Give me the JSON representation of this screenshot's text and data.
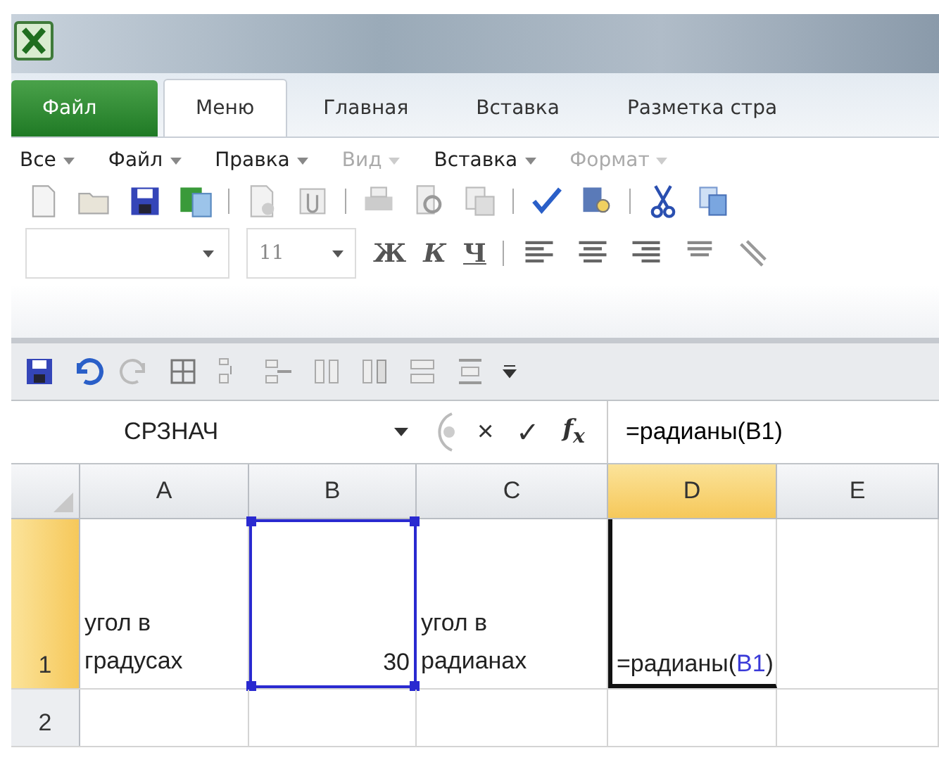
{
  "ribbon_tabs": [
    {
      "label": "Файл",
      "kind": "file",
      "selected": false
    },
    {
      "label": "Меню",
      "kind": "tab",
      "selected": true
    },
    {
      "label": "Главная",
      "kind": "tab",
      "selected": false
    },
    {
      "label": "Вставка",
      "kind": "tab",
      "selected": false
    },
    {
      "label": "Разметка стра",
      "kind": "tab",
      "selected": false
    }
  ],
  "menu": [
    {
      "label": "Все",
      "disabled": false
    },
    {
      "label": "Файл",
      "disabled": false
    },
    {
      "label": "Правка",
      "disabled": false
    },
    {
      "label": "Вид",
      "disabled": true
    },
    {
      "label": "Вставка",
      "disabled": false
    },
    {
      "label": "Формат",
      "disabled": true
    }
  ],
  "font_toolbar": {
    "font_size": "11",
    "bold": "Ж",
    "italic": "К",
    "underline": "Ч"
  },
  "formula_bar": {
    "name_box": "СРЗНАЧ",
    "cancel": "×",
    "enter": "✓",
    "function": "f$_{x}$",
    "formula": "=радианы(B1)"
  },
  "columns": [
    {
      "label": "A",
      "selected": false
    },
    {
      "label": "B",
      "selected": false
    },
    {
      "label": "C",
      "selected": false
    },
    {
      "label": "D",
      "selected": true
    },
    {
      "label": "E",
      "selected": false
    }
  ],
  "rows": [
    {
      "label": "1",
      "selected": true,
      "cells": [
        {
          "kind": "text",
          "value": "угол в градусах"
        },
        {
          "kind": "number",
          "value": "30",
          "referenced": true
        },
        {
          "kind": "text",
          "value": "угол в радианах"
        },
        {
          "kind": "editing",
          "segments": [
            {
              "text": "=радианы(",
              "reference": false
            },
            {
              "text": "B1",
              "reference": true
            },
            {
              "text": ")",
              "reference": false
            }
          ]
        },
        {
          "kind": "empty"
        }
      ]
    },
    {
      "label": "2",
      "selected": false,
      "cells": [
        {
          "kind": "empty"
        },
        {
          "kind": "empty"
        },
        {
          "kind": "empty"
        },
        {
          "kind": "empty"
        },
        {
          "kind": "empty"
        }
      ]
    }
  ]
}
